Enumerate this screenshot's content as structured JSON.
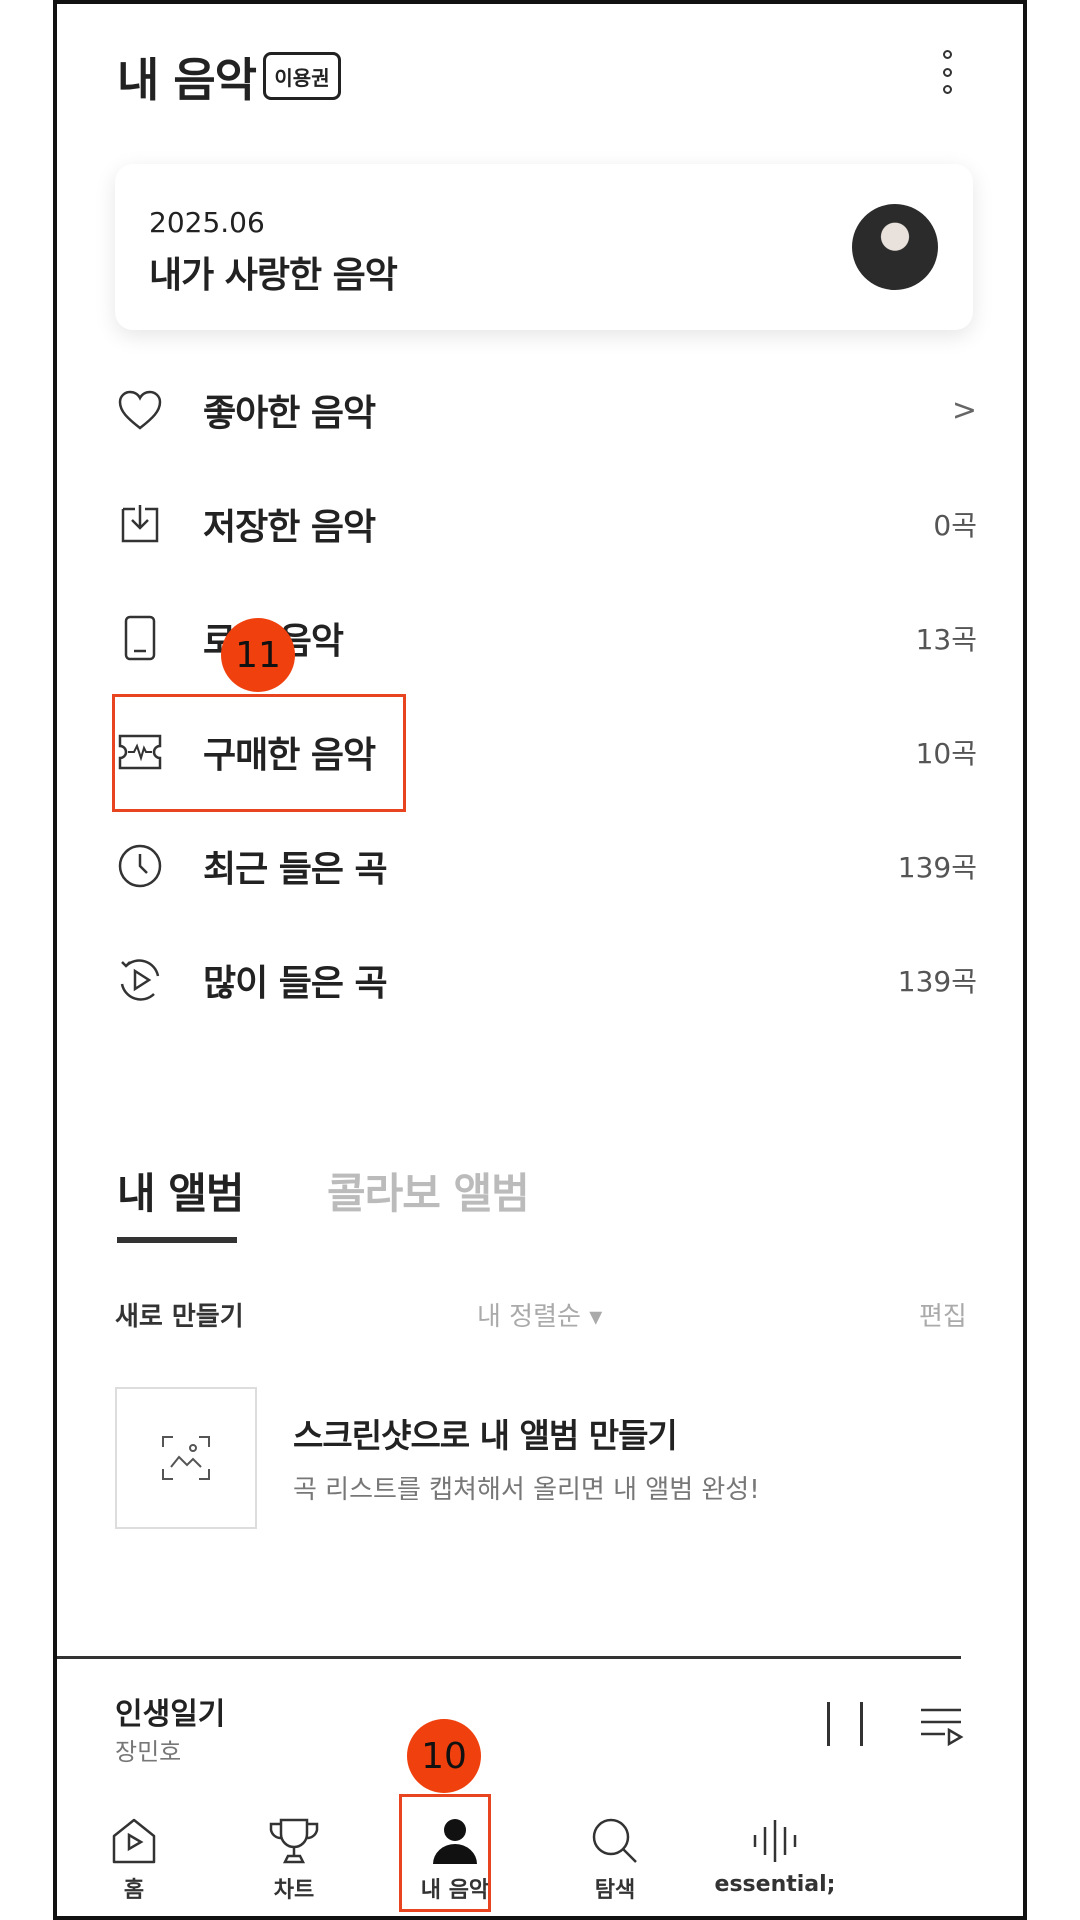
{
  "header": {
    "title": "내 음악",
    "badge": "이용권"
  },
  "monthly": {
    "date": "2025.06",
    "title": "내가 사랑한 음악"
  },
  "list": [
    {
      "label": "좋아한 음악",
      "count": "",
      "icon": "heart-icon"
    },
    {
      "label": "저장한 음악",
      "count": "0곡",
      "icon": "download-icon"
    },
    {
      "label": "로컬 음악",
      "count": "13곡",
      "icon": "phone-icon"
    },
    {
      "label": "구매한 음악",
      "count": "10곡",
      "icon": "ticket-icon"
    },
    {
      "label": "최근 들은 곡",
      "count": "139곡",
      "icon": "clock-icon"
    },
    {
      "label": "많이 들은 곡",
      "count": "139곡",
      "icon": "repeat-play-icon"
    }
  ],
  "tabs": {
    "mine": "내 앨범",
    "collab": "콜라보 앨범"
  },
  "controls": {
    "create": "새로 만들기",
    "sort": "내 정렬순 ▾",
    "edit": "편집"
  },
  "album_promo": {
    "title": "스크린샷으로 내 앨범 만들기",
    "subtitle": "곡 리스트를 캡쳐해서 올리면 내 앨범 완성!"
  },
  "player": {
    "song": "인생일기",
    "artist": "장민호"
  },
  "nav": [
    {
      "label": "홈",
      "icon": "home-icon"
    },
    {
      "label": "차트",
      "icon": "trophy-icon"
    },
    {
      "label": "내 음악",
      "icon": "person-icon"
    },
    {
      "label": "탐색",
      "icon": "search-icon"
    },
    {
      "label": "essential;",
      "icon": "waveform-icon"
    }
  ],
  "annotations": {
    "purchased": "11",
    "my_music_nav": "10"
  },
  "colors": {
    "highlight": "#e8441f",
    "bubble": "#f0400e"
  }
}
